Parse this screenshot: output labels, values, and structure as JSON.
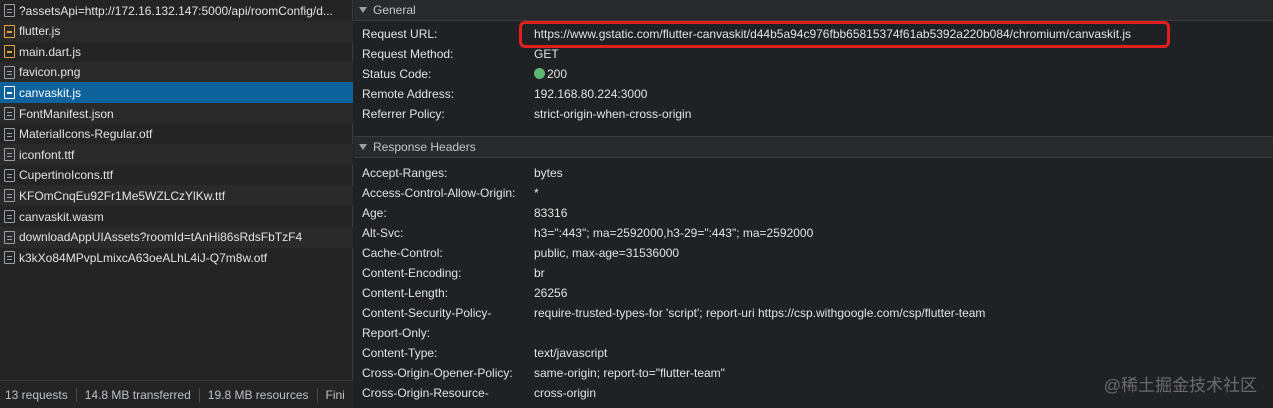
{
  "requests": [
    {
      "name": "?assetsApi=http://172.16.132.147:5000/api/roomConfig/d...",
      "icon": "doc"
    },
    {
      "name": "flutter.js",
      "icon": "script"
    },
    {
      "name": "main.dart.js",
      "icon": "script"
    },
    {
      "name": "favicon.png",
      "icon": "doc"
    },
    {
      "name": "canvaskit.js",
      "icon": "script",
      "selected": true
    },
    {
      "name": "FontManifest.json",
      "icon": "doc"
    },
    {
      "name": "MaterialIcons-Regular.otf",
      "icon": "doc"
    },
    {
      "name": "iconfont.ttf",
      "icon": "doc"
    },
    {
      "name": "CupertinoIcons.ttf",
      "icon": "doc"
    },
    {
      "name": "KFOmCnqEu92Fr1Me5WZLCzYlKw.ttf",
      "icon": "doc"
    },
    {
      "name": "canvaskit.wasm",
      "icon": "doc"
    },
    {
      "name": "downloadAppUIAssets?roomId=tAnHi86sRdsFbTzF4",
      "icon": "doc"
    },
    {
      "name": "k3kXo84MPvpLmixcA63oeALhL4iJ-Q7m8w.otf",
      "icon": "doc"
    }
  ],
  "summary": {
    "requests": "13 requests",
    "transferred": "14.8 MB transferred",
    "resources": "19.8 MB resources",
    "finish": "Fini"
  },
  "general": {
    "title": "General",
    "rows": [
      {
        "key": "Request URL:",
        "value": "https://www.gstatic.com/flutter-canvaskit/d44b5a94c976fbb65815374f61ab5392a220b084/chromium/canvaskit.js"
      },
      {
        "key": "Request Method:",
        "value": "GET"
      },
      {
        "key": "Status Code:",
        "value": "200"
      },
      {
        "key": "Remote Address:",
        "value": "192.168.80.224:3000"
      },
      {
        "key": "Referrer Policy:",
        "value": "strict-origin-when-cross-origin"
      }
    ]
  },
  "response_headers": {
    "title": "Response Headers",
    "rows": [
      {
        "key": "Accept-Ranges:",
        "value": "bytes"
      },
      {
        "key": "Access-Control-Allow-Origin:",
        "value": "*"
      },
      {
        "key": "Age:",
        "value": "83316"
      },
      {
        "key": "Alt-Svc:",
        "value": "h3=\":443\"; ma=2592000,h3-29=\":443\"; ma=2592000"
      },
      {
        "key": "Cache-Control:",
        "value": "public, max-age=31536000"
      },
      {
        "key": "Content-Encoding:",
        "value": "br"
      },
      {
        "key": "Content-Length:",
        "value": "26256"
      },
      {
        "key": "Content-Security-Policy-",
        "value": "require-trusted-types-for 'script'; report-uri https://csp.withgoogle.com/csp/flutter-team"
      },
      {
        "key": "Report-Only:",
        "value": ""
      },
      {
        "key": "Content-Type:",
        "value": "text/javascript"
      },
      {
        "key": "Cross-Origin-Opener-Policy:",
        "value": "same-origin; report-to=\"flutter-team\""
      },
      {
        "key": "Cross-Origin-Resource-",
        "value": "cross-origin"
      }
    ]
  },
  "watermark": "@稀土掘金技术社区"
}
